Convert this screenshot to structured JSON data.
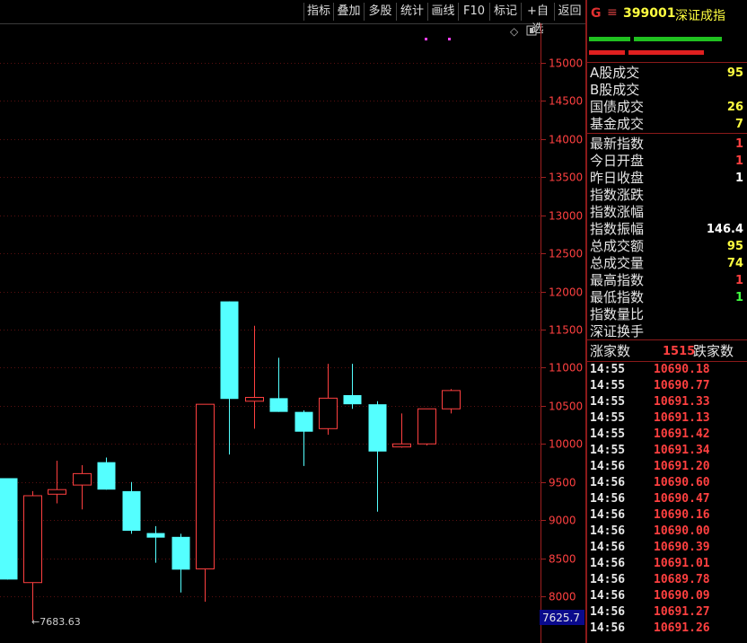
{
  "toolbar": {
    "buttons": [
      "指标",
      "叠加",
      "多股",
      "统计",
      "画线",
      "F10",
      "标记",
      "+自选",
      "返回"
    ]
  },
  "chart": {
    "y_axis": {
      "labels": [
        "15000",
        "14500",
        "14000",
        "13500",
        "13000",
        "12500",
        "12000",
        "11500",
        "11000",
        "10500",
        "10000",
        "9500",
        "9000",
        "8500",
        "8000"
      ],
      "values": [
        15000,
        14500,
        14000,
        13500,
        13000,
        12500,
        12000,
        11500,
        11000,
        10500,
        10000,
        9500,
        9000,
        8500,
        8000
      ]
    },
    "current_value": "7625.7",
    "low_annotation": "←7683.63",
    "colors": {
      "up": "#ff4040",
      "down": "#54ffff",
      "axis": "#a02020",
      "grid": "#5a1010"
    }
  },
  "chart_data": {
    "type": "candlestick",
    "ylim": [
      7625.7,
      15350
    ],
    "y_ticks": [
      15000,
      14500,
      14000,
      13500,
      13000,
      12500,
      12000,
      11500,
      11000,
      10500,
      10000,
      9500,
      9000,
      8500,
      8000
    ],
    "candles": [
      {
        "open": 9550,
        "close": 8220,
        "high": 9550,
        "low": 8220,
        "dir": "down"
      },
      {
        "open": 8180,
        "close": 9320,
        "high": 9380,
        "low": 7683.63,
        "dir": "up"
      },
      {
        "open": 9340,
        "close": 9400,
        "high": 9780,
        "low": 9220,
        "dir": "up"
      },
      {
        "open": 9460,
        "close": 9610,
        "high": 9720,
        "low": 9140,
        "dir": "up"
      },
      {
        "open": 9760,
        "close": 9400,
        "high": 9820,
        "low": 9400,
        "dir": "down"
      },
      {
        "open": 9380,
        "close": 8860,
        "high": 9500,
        "low": 8820,
        "dir": "down"
      },
      {
        "open": 8830,
        "close": 8770,
        "high": 8920,
        "low": 8440,
        "dir": "down"
      },
      {
        "open": 8780,
        "close": 8350,
        "high": 8820,
        "low": 8050,
        "dir": "down"
      },
      {
        "open": 8360,
        "close": 10520,
        "high": 10520,
        "low": 7930,
        "dir": "up"
      },
      {
        "open": 11870,
        "close": 10590,
        "high": 11870,
        "low": 9860,
        "dir": "down"
      },
      {
        "open": 10560,
        "close": 10610,
        "high": 11550,
        "low": 10200,
        "dir": "up"
      },
      {
        "open": 10600,
        "close": 10420,
        "high": 11130,
        "low": 10420,
        "dir": "down"
      },
      {
        "open": 10420,
        "close": 10160,
        "high": 10440,
        "low": 9710,
        "dir": "down"
      },
      {
        "open": 10200,
        "close": 10600,
        "high": 11050,
        "low": 10120,
        "dir": "up"
      },
      {
        "open": 10640,
        "close": 10520,
        "high": 11050,
        "low": 10460,
        "dir": "down"
      },
      {
        "open": 10520,
        "close": 9900,
        "high": 10560,
        "low": 9110,
        "dir": "down"
      },
      {
        "open": 9960,
        "close": 10000,
        "high": 10400,
        "low": 9950,
        "dir": "up"
      },
      {
        "open": 10000,
        "close": 10460,
        "high": 10460,
        "low": 9980,
        "dir": "up"
      },
      {
        "open": 10460,
        "close": 10700,
        "high": 10720,
        "low": 10400,
        "dir": "up"
      }
    ]
  },
  "panel": {
    "header": {
      "g": "G",
      "menu": "≡",
      "code": "399001",
      "name": "深证成指"
    },
    "stats": [
      {
        "label": "A股成交",
        "value": "95",
        "color": "#ffff40"
      },
      {
        "label": "B股成交",
        "value": "",
        "color": "#ffff40"
      },
      {
        "label": "国债成交",
        "value": "26",
        "color": "#ffff40"
      },
      {
        "label": "基金成交",
        "value": "7",
        "color": "#ffff40"
      },
      {
        "label": "最新指数",
        "value": "1",
        "color": "#ff4040"
      },
      {
        "label": "今日开盘",
        "value": "1",
        "color": "#ff4040"
      },
      {
        "label": "昨日收盘",
        "value": "1",
        "color": "#ffffff"
      },
      {
        "label": "指数涨跌",
        "value": "",
        "color": "#ff4040"
      },
      {
        "label": "指数涨幅",
        "value": "",
        "color": "#ff4040"
      },
      {
        "label": "指数振幅",
        "value": "146.4",
        "color": "#ffffff"
      },
      {
        "label": "总成交额",
        "value": "95",
        "color": "#ffff40"
      },
      {
        "label": "总成交量",
        "value": "74",
        "color": "#ffff40"
      },
      {
        "label": "最高指数",
        "value": "1",
        "color": "#ff4040"
      },
      {
        "label": "最低指数",
        "value": "1",
        "color": "#40ff40"
      },
      {
        "label": "指数量比",
        "value": "",
        "color": "#ffffff"
      },
      {
        "label": "深证换手",
        "value": "",
        "color": "#ffffff"
      }
    ],
    "rise_fall": {
      "rise_label": "涨家数",
      "rise_count": "1515",
      "fall_label": "跌家数"
    },
    "ticks": [
      {
        "time": "14:55",
        "price": "10690.18"
      },
      {
        "time": "14:55",
        "price": "10690.77"
      },
      {
        "time": "14:55",
        "price": "10691.33"
      },
      {
        "time": "14:55",
        "price": "10691.13"
      },
      {
        "time": "14:55",
        "price": "10691.42"
      },
      {
        "time": "14:55",
        "price": "10691.34"
      },
      {
        "time": "14:56",
        "price": "10691.20"
      },
      {
        "time": "14:56",
        "price": "10690.60"
      },
      {
        "time": "14:56",
        "price": "10690.47"
      },
      {
        "time": "14:56",
        "price": "10690.16"
      },
      {
        "time": "14:56",
        "price": "10690.00"
      },
      {
        "time": "14:56",
        "price": "10690.39"
      },
      {
        "time": "14:56",
        "price": "10691.01"
      },
      {
        "time": "14:56",
        "price": "10689.78"
      },
      {
        "time": "14:56",
        "price": "10690.09"
      },
      {
        "time": "14:56",
        "price": "10691.27"
      },
      {
        "time": "14:56",
        "price": "10691.26"
      }
    ]
  }
}
